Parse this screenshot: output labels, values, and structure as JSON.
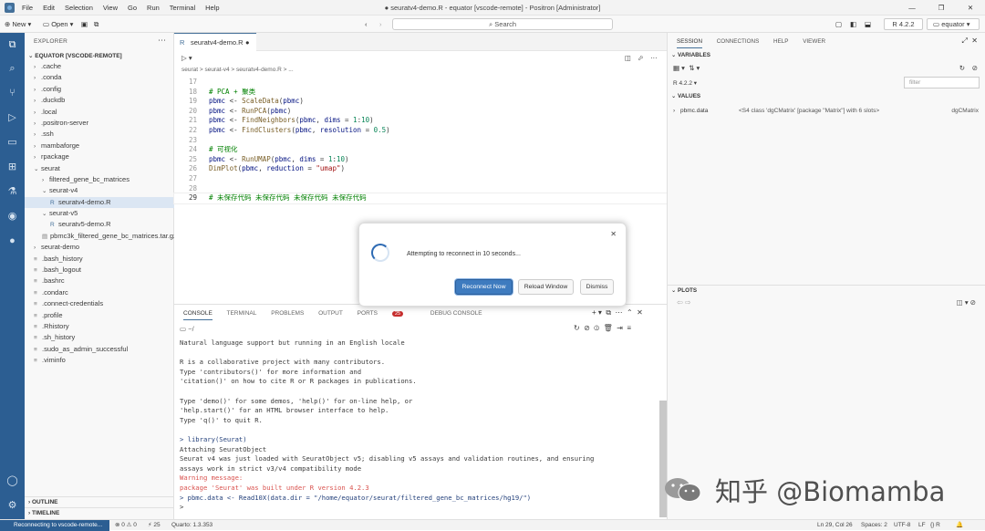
{
  "window": {
    "menu": [
      "File",
      "Edit",
      "Selection",
      "View",
      "Go",
      "Run",
      "Terminal",
      "Help"
    ],
    "title": "● seuratv4-demo.R - equator [vscode-remote] - Positron [Administrator]",
    "controls": [
      "—",
      "❐",
      "✕"
    ]
  },
  "toolbar": {
    "new_label": "New",
    "open_label": "Open",
    "search_placeholder": "Search",
    "r_version": "R 4.2.2",
    "env_name": "equator"
  },
  "explorer": {
    "header": "EXPLORER",
    "root": "EQUATOR [VSCODE-REMOTE]",
    "items": [
      {
        "label": ".cache",
        "depth": 0,
        "kind": "folder",
        "open": false
      },
      {
        "label": ".conda",
        "depth": 0,
        "kind": "folder",
        "open": false
      },
      {
        "label": ".config",
        "depth": 0,
        "kind": "folder",
        "open": false
      },
      {
        "label": ".duckdb",
        "depth": 0,
        "kind": "folder",
        "open": false
      },
      {
        "label": ".local",
        "depth": 0,
        "kind": "folder",
        "open": false
      },
      {
        "label": ".positron-server",
        "depth": 0,
        "kind": "folder",
        "open": false
      },
      {
        "label": ".ssh",
        "depth": 0,
        "kind": "folder",
        "open": false
      },
      {
        "label": "mambaforge",
        "depth": 0,
        "kind": "folder",
        "open": false
      },
      {
        "label": "rpackage",
        "depth": 0,
        "kind": "folder",
        "open": false
      },
      {
        "label": "seurat",
        "depth": 0,
        "kind": "folder",
        "open": true
      },
      {
        "label": "filtered_gene_bc_matrices",
        "depth": 1,
        "kind": "folder",
        "open": false
      },
      {
        "label": "seurat-v4",
        "depth": 1,
        "kind": "folder",
        "open": true
      },
      {
        "label": "seuratv4-demo.R",
        "depth": 2,
        "kind": "file",
        "selected": true
      },
      {
        "label": "seurat-v5",
        "depth": 1,
        "kind": "folder",
        "open": true
      },
      {
        "label": "seuratv5-demo.R",
        "depth": 2,
        "kind": "file"
      },
      {
        "label": "pbmc3k_filtered_gene_bc_matrices.tar.gz",
        "depth": 1,
        "kind": "file"
      },
      {
        "label": "seurat-demo",
        "depth": 0,
        "kind": "folder",
        "open": false
      },
      {
        "label": ".bash_history",
        "depth": 0,
        "kind": "file"
      },
      {
        "label": ".bash_logout",
        "depth": 0,
        "kind": "file"
      },
      {
        "label": ".bashrc",
        "depth": 0,
        "kind": "file"
      },
      {
        "label": ".condarc",
        "depth": 0,
        "kind": "file"
      },
      {
        "label": ".connect-credentials",
        "depth": 0,
        "kind": "file"
      },
      {
        "label": ".profile",
        "depth": 0,
        "kind": "file"
      },
      {
        "label": ".Rhistory",
        "depth": 0,
        "kind": "file"
      },
      {
        "label": ".sh_history",
        "depth": 0,
        "kind": "file"
      },
      {
        "label": ".sudo_as_admin_successful",
        "depth": 0,
        "kind": "file"
      },
      {
        "label": ".viminfo",
        "depth": 0,
        "kind": "file"
      }
    ],
    "outline": "OUTLINE",
    "timeline": "TIMELINE"
  },
  "editor": {
    "tab_label": "seuratv4-demo.R",
    "breadcrumbs": "seurat > seurat-v4 > seuratv4-demo.R > ...",
    "lines": [
      {
        "n": "17",
        "html": ""
      },
      {
        "n": "18",
        "html": "<span class=\"cm\"># PCA + 聚类</span>"
      },
      {
        "n": "19",
        "html": "<span class=\"vr\">pbmc</span> &lt;- <span class=\"fn\">ScaleData</span>(<span class=\"vr\">pbmc</span>)"
      },
      {
        "n": "20",
        "html": "<span class=\"vr\">pbmc</span> &lt;- <span class=\"fn\">RunPCA</span>(<span class=\"vr\">pbmc</span>)"
      },
      {
        "n": "21",
        "html": "<span class=\"vr\">pbmc</span> &lt;- <span class=\"fn\">FindNeighbors</span>(<span class=\"vr\">pbmc</span>, <span class=\"vr\">dims</span> = <span class=\"num\">1</span>:<span class=\"num\">10</span>)"
      },
      {
        "n": "22",
        "html": "<span class=\"vr\">pbmc</span> &lt;- <span class=\"fn\">FindClusters</span>(<span class=\"vr\">pbmc</span>, <span class=\"vr\">resolution</span> = <span class=\"num\">0.5</span>)"
      },
      {
        "n": "23",
        "html": ""
      },
      {
        "n": "24",
        "html": "<span class=\"cm\"># 可视化</span>"
      },
      {
        "n": "25",
        "html": "<span class=\"vr\">pbmc</span> &lt;- <span class=\"fn\">RunUMAP</span>(<span class=\"vr\">pbmc</span>, <span class=\"vr\">dims</span> = <span class=\"num\">1</span>:<span class=\"num\">10</span>)"
      },
      {
        "n": "26",
        "html": "<span class=\"fn\">DimPlot</span>(<span class=\"vr\">pbmc</span>, <span class=\"vr\">reduction</span> = <span class=\"str\">\"umap\"</span>)"
      },
      {
        "n": "27",
        "html": ""
      },
      {
        "n": "28",
        "html": ""
      },
      {
        "n": "29",
        "html": "<span class=\"cm\"># 未保存代码 未保存代码 未保存代码 未保存代码</span>"
      }
    ]
  },
  "panel": {
    "tabs": [
      "CONSOLE",
      "TERMINAL",
      "PROBLEMS",
      "OUTPUT",
      "PORTS",
      "DEBUG CONSOLE"
    ],
    "ports_count": "25",
    "cwd": "~/",
    "console_lines": [
      {
        "t": "Natural language support but running in an English locale",
        "c": ""
      },
      {
        "t": "",
        "c": ""
      },
      {
        "t": "R is a collaborative project with many contributors.",
        "c": ""
      },
      {
        "t": "Type 'contributors()' for more information and",
        "c": ""
      },
      {
        "t": "'citation()' on how to cite R or R packages in publications.",
        "c": ""
      },
      {
        "t": "",
        "c": ""
      },
      {
        "t": "Type 'demo()' for some demos, 'help()' for on-line help, or",
        "c": ""
      },
      {
        "t": "'help.start()' for an HTML browser interface to help.",
        "c": ""
      },
      {
        "t": "Type 'q()' to quit R.",
        "c": ""
      },
      {
        "t": "",
        "c": ""
      },
      {
        "t": "> library(Seurat)",
        "c": "inp"
      },
      {
        "t": "Attaching SeuratObject",
        "c": ""
      },
      {
        "t": "Seurat v4 was just loaded with SeuratObject v5; disabling v5 assays and validation routines, and ensuring",
        "c": ""
      },
      {
        "t": "assays work in strict v3/v4 compatibility mode",
        "c": ""
      },
      {
        "t": "Warning message:",
        "c": "warn"
      },
      {
        "t": "package 'Seurat' was built under R version 4.2.3",
        "c": "warn"
      },
      {
        "t": "> pbmc.data <- Read10X(data.dir = \"/home/equator/seurat/filtered_gene_bc_matrices/hg19/\")",
        "c": "inp"
      },
      {
        "t": ">",
        "c": "prm"
      }
    ]
  },
  "right": {
    "tabs": [
      "SESSION",
      "CONNECTIONS",
      "HELP",
      "VIEWER"
    ],
    "variables_header": "VARIABLES",
    "r_session": "R 4.2.2",
    "filter_placeholder": "filter",
    "values_header": "VALUES",
    "var_name": "pbmc.data",
    "var_value": "<S4 class 'dgCMatrix' [package \"Matrix\"] with 6 slots>",
    "var_type": "dgCMatrix",
    "plots_header": "PLOTS"
  },
  "dialog": {
    "message": "Attempting to reconnect in 10 seconds...",
    "reconnect": "Reconnect Now",
    "reload": "Reload Window",
    "dismiss": "Dismiss"
  },
  "status": {
    "remote": "Reconnecting to vscode-remote...",
    "problems": "⊗ 0 ⚠ 0",
    "ports": "⚡ 25",
    "quarto": "Quarto: 1.3.353",
    "position": "Ln 29, Col 26",
    "spaces": "Spaces: 2",
    "encoding": "UTF-8",
    "eol": "LF",
    "lang": "{} R"
  },
  "watermark": {
    "text": "知乎 @Biomamba"
  }
}
